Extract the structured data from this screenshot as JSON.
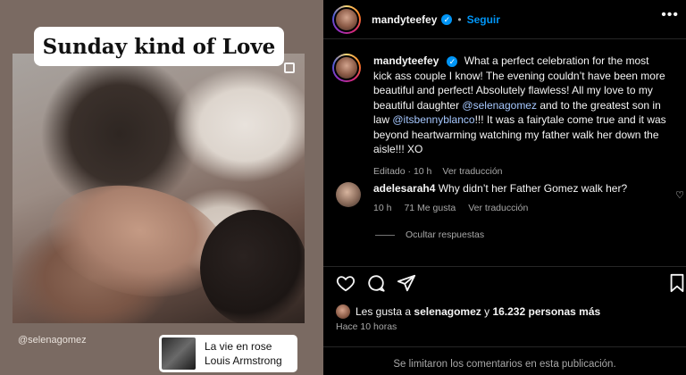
{
  "media": {
    "caption_overlay": "Sunday kind of Love",
    "tag": "@selenagomez",
    "music": {
      "title": "La vie en rose",
      "artist": "Louis Armstrong"
    }
  },
  "header": {
    "username": "mandyteefey",
    "separator": "•",
    "follow_label": "Seguir",
    "more_icon": "more-horizontal-icon"
  },
  "post": {
    "username": "mandyteefey",
    "text_1": "What a perfect celebration for the most kick ass couple I know! The evening couldn’t have been more beautiful and perfect! Absolutely flawless! All my love to my beautiful daughter ",
    "mention_1": "@selenagomez",
    "text_2": " and to the greatest son in law ",
    "mention_2": "@itsbennyblanco",
    "text_3": "!!! It was a fairytale come true and it was beyond heartwarming watching my father walk her down the aisle!!! XO",
    "edited": "Editado · 10 h",
    "translate": "Ver traducción"
  },
  "comment": {
    "username": "adelesarah4",
    "text": "Why didn’t her Father Gomez walk her?",
    "time": "10 h",
    "likes": "71 Me gusta",
    "translate": "Ver traducción",
    "hide_replies": "Ocultar respuestas"
  },
  "likes_line": {
    "prefix": "Les gusta a ",
    "user": "selenagomez",
    "middle": " y ",
    "count": "16.232 personas más"
  },
  "time_ago": "Hace 10 horas",
  "comments_limited": "Se limitaron los comentarios en esta publicación.",
  "colors": {
    "accent": "#0095f6",
    "background": "#000000",
    "muted": "#a8a8a8"
  }
}
